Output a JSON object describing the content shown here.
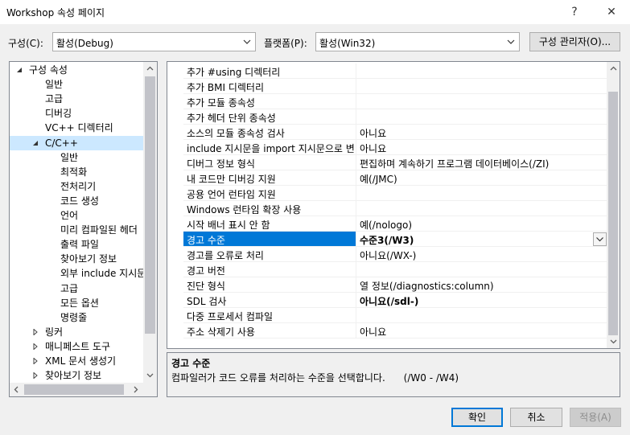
{
  "window": {
    "title": "Workshop 속성 페이지",
    "help_glyph": "?",
    "close_glyph": "✕"
  },
  "config_bar": {
    "config_label": "구성(C):",
    "config_value": "활성(Debug)",
    "platform_label": "플랫폼(P):",
    "platform_value": "활성(Win32)",
    "manager_button": "구성 관리자(O)..."
  },
  "tree": {
    "items": [
      {
        "label": "구성 속성",
        "level": 0,
        "twisty": "expanded"
      },
      {
        "label": "일반",
        "level": 1,
        "twisty": "none"
      },
      {
        "label": "고급",
        "level": 1,
        "twisty": "none"
      },
      {
        "label": "디버깅",
        "level": 1,
        "twisty": "none"
      },
      {
        "label": "VC++ 디렉터리",
        "level": 1,
        "twisty": "none"
      },
      {
        "label": "C/C++",
        "level": 1,
        "twisty": "expanded",
        "selected": true
      },
      {
        "label": "일반",
        "level": 2,
        "twisty": "none"
      },
      {
        "label": "최적화",
        "level": 2,
        "twisty": "none"
      },
      {
        "label": "전처리기",
        "level": 2,
        "twisty": "none"
      },
      {
        "label": "코드 생성",
        "level": 2,
        "twisty": "none"
      },
      {
        "label": "언어",
        "level": 2,
        "twisty": "none"
      },
      {
        "label": "미리 컴파일된 헤더",
        "level": 2,
        "twisty": "none"
      },
      {
        "label": "출력 파일",
        "level": 2,
        "twisty": "none"
      },
      {
        "label": "찾아보기 정보",
        "level": 2,
        "twisty": "none"
      },
      {
        "label": "외부 include 지시문",
        "level": 2,
        "twisty": "none"
      },
      {
        "label": "고급",
        "level": 2,
        "twisty": "none"
      },
      {
        "label": "모든 옵션",
        "level": 2,
        "twisty": "none"
      },
      {
        "label": "명령줄",
        "level": 2,
        "twisty": "none"
      },
      {
        "label": "링커",
        "level": 1,
        "twisty": "collapsed"
      },
      {
        "label": "매니페스트 도구",
        "level": 1,
        "twisty": "collapsed"
      },
      {
        "label": "XML 문서 생성기",
        "level": 1,
        "twisty": "collapsed"
      },
      {
        "label": "찾아보기 정보",
        "level": 1,
        "twisty": "collapsed"
      }
    ]
  },
  "properties": {
    "rows": [
      {
        "name": "추가 #using 디렉터리",
        "value": ""
      },
      {
        "name": "추가 BMI 디렉터리",
        "value": ""
      },
      {
        "name": "추가 모듈 종속성",
        "value": ""
      },
      {
        "name": "추가 헤더 단위 종속성",
        "value": ""
      },
      {
        "name": "소스의 모듈 종속성 검사",
        "value": "아니요"
      },
      {
        "name": "include 지시문을 import 지시문으로 변",
        "value": "아니요"
      },
      {
        "name": "디버그 정보 형식",
        "value": "편집하며 계속하기 프로그램 데이터베이스(/ZI)"
      },
      {
        "name": "내 코드만 디버깅 지원",
        "value": "예(/JMC)"
      },
      {
        "name": "공용 언어 런타임 지원",
        "value": ""
      },
      {
        "name": "Windows 런타임 확장 사용",
        "value": ""
      },
      {
        "name": "시작 배너 표시 안 함",
        "value": "예(/nologo)"
      },
      {
        "name": "경고 수준",
        "value": "수준3(/W3)",
        "selected": true,
        "bold": true
      },
      {
        "name": "경고를 오류로 처리",
        "value": "아니요(/WX-)"
      },
      {
        "name": "경고 버전",
        "value": ""
      },
      {
        "name": "진단 형식",
        "value": "열 정보(/diagnostics:column)"
      },
      {
        "name": "SDL 검사",
        "value": "아니요(/sdl-)",
        "bold": true
      },
      {
        "name": "다중 프로세서 컴파일",
        "value": ""
      },
      {
        "name": "주소 삭제기 사용",
        "value": "아니요"
      }
    ]
  },
  "description": {
    "title": "경고 수준",
    "text": "컴파일러가 코드 오류를 처리하는 수준을 선택합니다.      (/W0 - /W4)"
  },
  "footer": {
    "ok": "확인",
    "cancel": "취소",
    "apply": "적용(A)"
  }
}
